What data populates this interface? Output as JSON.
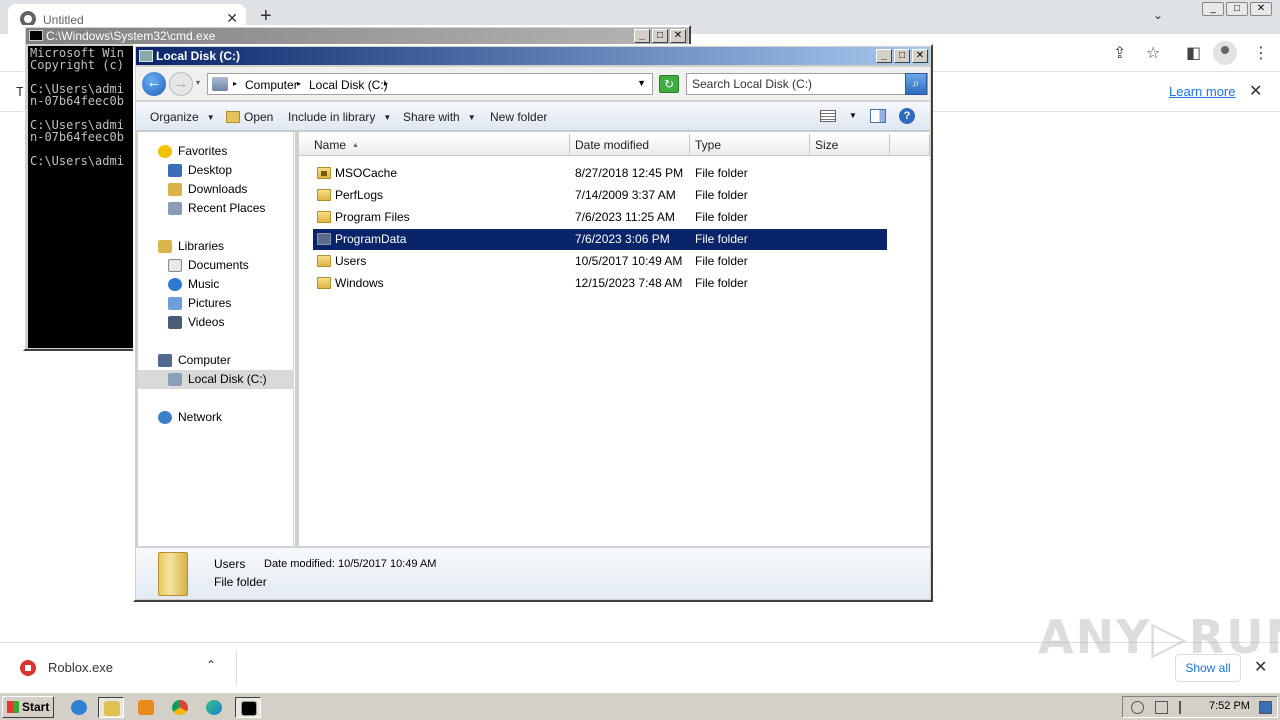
{
  "browser": {
    "tab_title": "Untitled",
    "tab_close": "✕",
    "new_tab": "+",
    "tabstrip_chevron": "⌄",
    "infobar_text": "T",
    "learn_more": "Learn more",
    "infobar_close": "✕",
    "download_file": "Roblox.exe",
    "download_chevron": "⌃",
    "show_all": "Show all",
    "download_close": "✕",
    "watermark": "ANY▷RUN"
  },
  "cmd": {
    "title": "C:\\Windows\\System32\\cmd.exe",
    "lines": "Microsoft Win\nCopyright (c)\n\nC:\\Users\\admi\nn-07b64feec0b\n\nC:\\Users\\admi\nn-07b64feec0b\n\nC:\\Users\\admi"
  },
  "explorer": {
    "title": "Local Disk (C:)",
    "back": "←",
    "forward": "→",
    "history_drop": "▾",
    "breadcrumb": [
      "Computer",
      "Local Disk (C:)"
    ],
    "crumb_arrow": "▸",
    "address_drop": "▼",
    "refresh": "↻",
    "search_placeholder": "Search Local Disk (C:)",
    "search_icon": "⌕",
    "commands": {
      "organize": "Organize",
      "open": "Open",
      "include_in_library": "Include in library",
      "share_with": "Share with",
      "new_folder": "New folder",
      "drop": "▼",
      "help": "?"
    },
    "nav": {
      "favorites": "Favorites",
      "desktop": "Desktop",
      "downloads": "Downloads",
      "recent_places": "Recent Places",
      "libraries": "Libraries",
      "documents": "Documents",
      "music": "Music",
      "pictures": "Pictures",
      "videos": "Videos",
      "computer": "Computer",
      "local_disk": "Local Disk (C:)",
      "network": "Network"
    },
    "columns": {
      "name": "Name",
      "date_modified": "Date modified",
      "type": "Type",
      "size": "Size",
      "sort_indicator": "▲"
    },
    "files": [
      {
        "name": "MSOCache",
        "date": "8/27/2018 12:45 PM",
        "type": "File folder"
      },
      {
        "name": "PerfLogs",
        "date": "7/14/2009 3:37 AM",
        "type": "File folder"
      },
      {
        "name": "Program Files",
        "date": "7/6/2023 11:25 AM",
        "type": "File folder"
      },
      {
        "name": "ProgramData",
        "date": "7/6/2023 3:06 PM",
        "type": "File folder"
      },
      {
        "name": "Users",
        "date": "10/5/2017 10:49 AM",
        "type": "File folder"
      },
      {
        "name": "Windows",
        "date": "12/15/2023 7:48 AM",
        "type": "File folder"
      }
    ],
    "selected_row": "ProgramData",
    "details": {
      "name": "Users",
      "date_modified": "Date modified: 10/5/2017 10:49 AM",
      "type": "File folder"
    }
  },
  "window_captions": {
    "minimize": "_",
    "maximize": "□",
    "close": "✕"
  },
  "taskbar": {
    "start": "Start",
    "clock": "7:52 PM"
  },
  "colors": {
    "selection": "#0a246a",
    "title_active": "#0a246a",
    "link": "#1a73e8"
  }
}
